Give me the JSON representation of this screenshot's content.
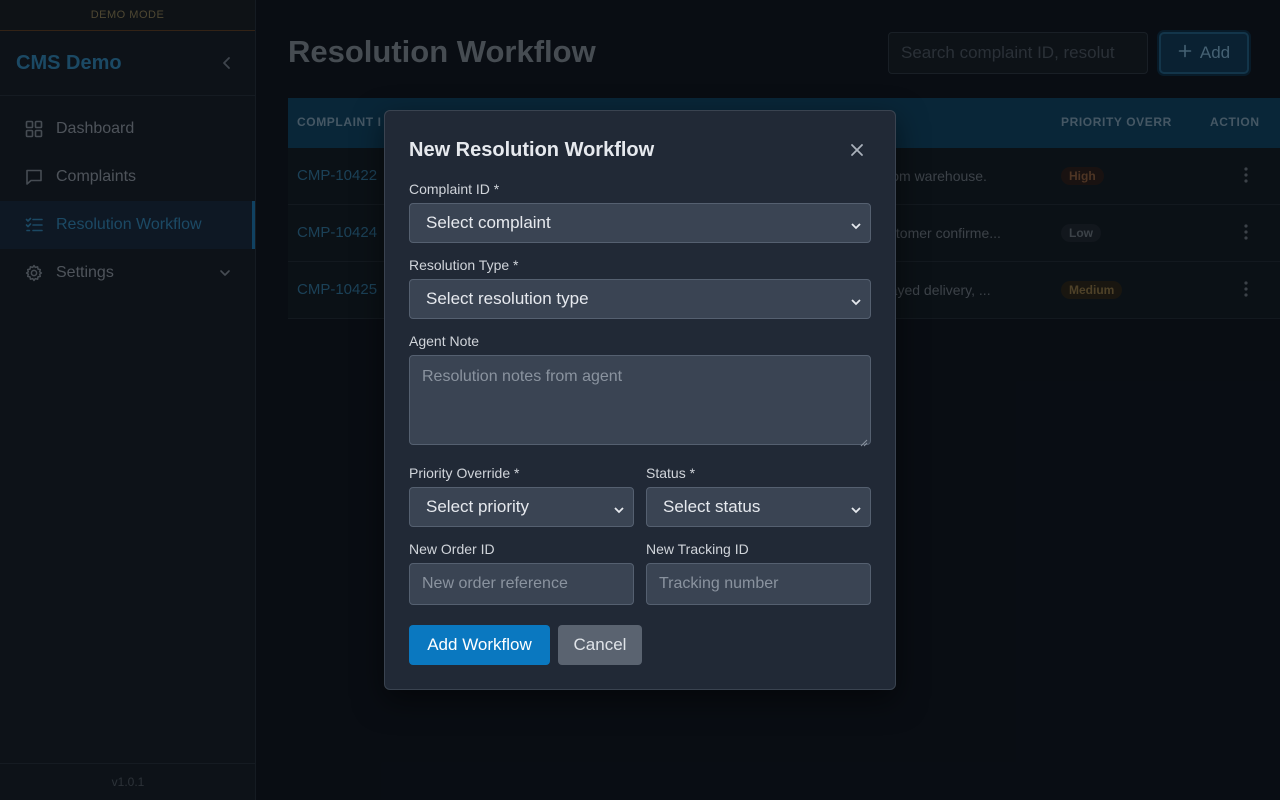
{
  "sidebar": {
    "banner": "DEMO MODE",
    "brand": "CMS Demo",
    "items": [
      {
        "label": "Dashboard",
        "icon": "dashboard-icon"
      },
      {
        "label": "Complaints",
        "icon": "chat-icon"
      },
      {
        "label": "Resolution Workflow",
        "icon": "checklist-icon",
        "active": true
      },
      {
        "label": "Settings",
        "icon": "gear-icon"
      }
    ],
    "version": "v1.0.1"
  },
  "main": {
    "title": "Resolution Workflow",
    "search_placeholder": "Search complaint ID, resolut",
    "add_label": "Add",
    "table": {
      "headers": {
        "complaint_id": "COMPLAINT I",
        "priority": "PRIORITY OVERR",
        "action": "ACTION"
      },
      "rows": [
        {
          "id": "CMP-10422",
          "note": "d from warehouse.",
          "priority": "High"
        },
        {
          "id": "CMP-10424",
          "note": "Customer confirme...",
          "priority": "Low"
        },
        {
          "id": "CMP-10425",
          "note": "delayed delivery, ...",
          "priority": "Medium"
        }
      ]
    }
  },
  "modal": {
    "title": "New Resolution Workflow",
    "complaint_id_label": "Complaint ID *",
    "complaint_id_value": "Select complaint",
    "resolution_type_label": "Resolution Type *",
    "resolution_type_value": "Select resolution type",
    "agent_note_label": "Agent Note",
    "agent_note_placeholder": "Resolution notes from agent",
    "priority_label": "Priority Override *",
    "priority_value": "Select priority",
    "status_label": "Status *",
    "status_value": "Select status",
    "new_order_label": "New Order ID",
    "new_order_placeholder": "New order reference",
    "tracking_label": "New Tracking ID",
    "tracking_placeholder": "Tracking number",
    "submit_label": "Add Workflow",
    "cancel_label": "Cancel"
  },
  "colors": {
    "accent": "#0a78c0",
    "brand": "#2f7fae",
    "modal_bg": "#212936",
    "field_bg": "#3a4453"
  }
}
